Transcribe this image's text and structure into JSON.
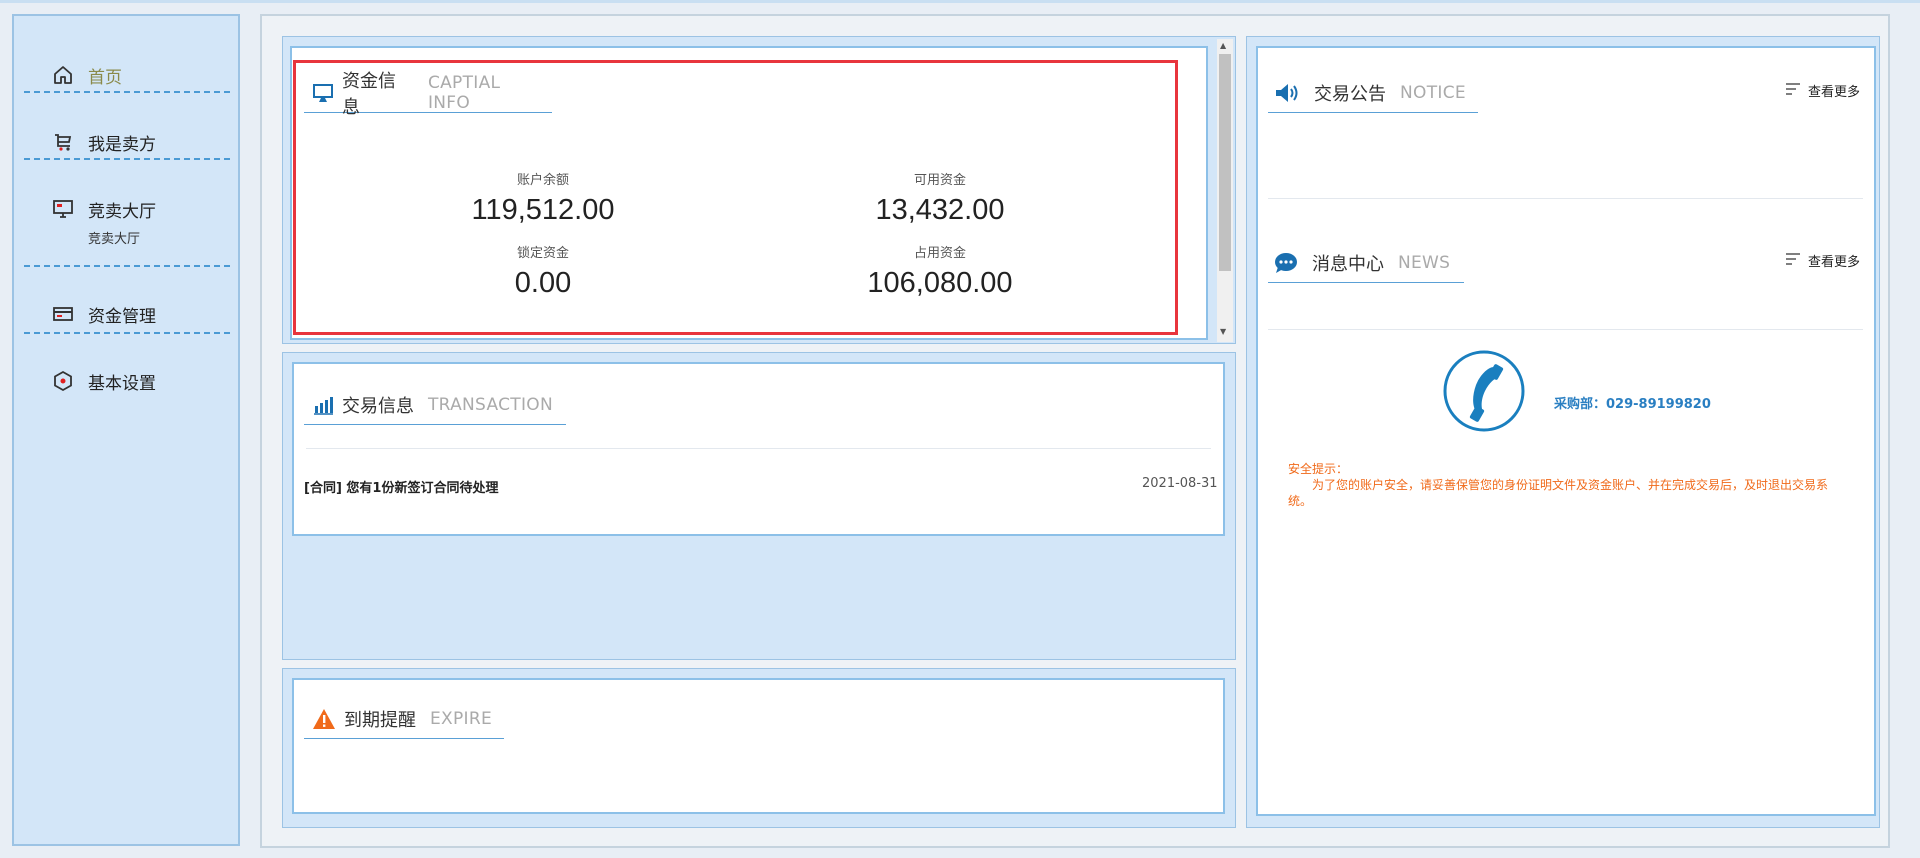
{
  "sidebar": {
    "items": [
      {
        "label": "首页",
        "icon": "home-icon"
      },
      {
        "label": "我是卖方",
        "icon": "cart-icon"
      },
      {
        "label": "竞卖大厅",
        "icon": "monitor-icon",
        "sub": "竞卖大厅"
      },
      {
        "label": "资金管理",
        "icon": "card-icon"
      },
      {
        "label": "基本设置",
        "icon": "settings-icon"
      }
    ]
  },
  "capital": {
    "title_zh": "资金信息",
    "title_en": "CAPTIAL INFO",
    "stats": [
      {
        "label": "账户余额",
        "value": "119,512.00"
      },
      {
        "label": "可用资金",
        "value": "13,432.00"
      },
      {
        "label": "锁定资金",
        "value": "0.00"
      },
      {
        "label": "占用资金",
        "value": "106,080.00"
      }
    ]
  },
  "transaction": {
    "title_zh": "交易信息",
    "title_en": "TRANSACTION",
    "rows": [
      {
        "text": "[合同] 您有1份新签订合同待处理",
        "date": "2021-08-31"
      }
    ]
  },
  "expire": {
    "title_zh": "到期提醒",
    "title_en": "EXPIRE"
  },
  "notice": {
    "title_zh": "交易公告",
    "title_en": "NOTICE",
    "more": "查看更多"
  },
  "news": {
    "title_zh": "消息中心",
    "title_en": "NEWS",
    "more": "查看更多"
  },
  "contact": {
    "phone": "采购部：029-89199820"
  },
  "safety": {
    "title": "安全提示：",
    "line1": "为了您的账户安全，请妥善保管您的身份证明文件及资金账户、并在完成交易后，及时退出交易系",
    "line2": "统。"
  },
  "colors": {
    "accent": "#1a6fb0",
    "panel_bg": "#d3e6f8",
    "highlight_box": "#e8353d",
    "warning": "#f06a1a"
  }
}
